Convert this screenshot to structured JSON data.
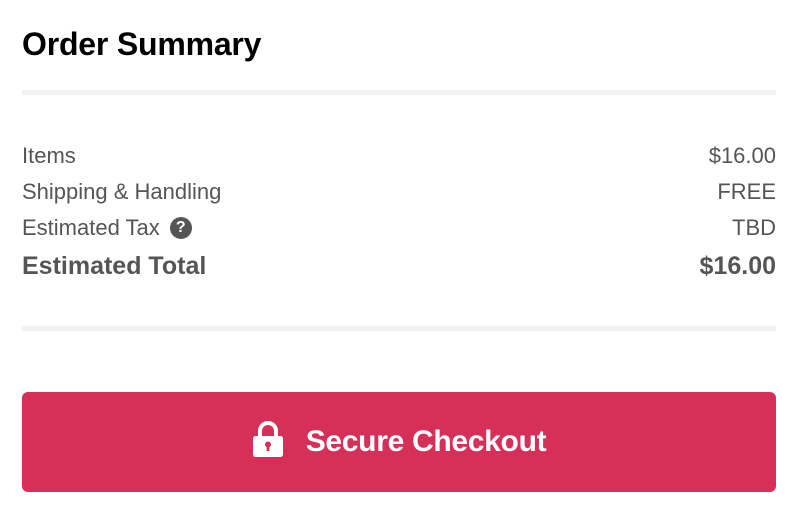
{
  "order_summary": {
    "title": "Order Summary",
    "lines": [
      {
        "label": "Items",
        "value": "$16.00"
      },
      {
        "label": "Shipping & Handling",
        "value": "FREE"
      },
      {
        "label": "Estimated Tax",
        "value": "TBD",
        "help_icon": "question-circle-icon"
      }
    ],
    "total": {
      "label": "Estimated Total",
      "value": "$16.00"
    }
  },
  "checkout_button": {
    "label": "Secure Checkout",
    "icon": "lock-icon",
    "color": "#d63059"
  }
}
